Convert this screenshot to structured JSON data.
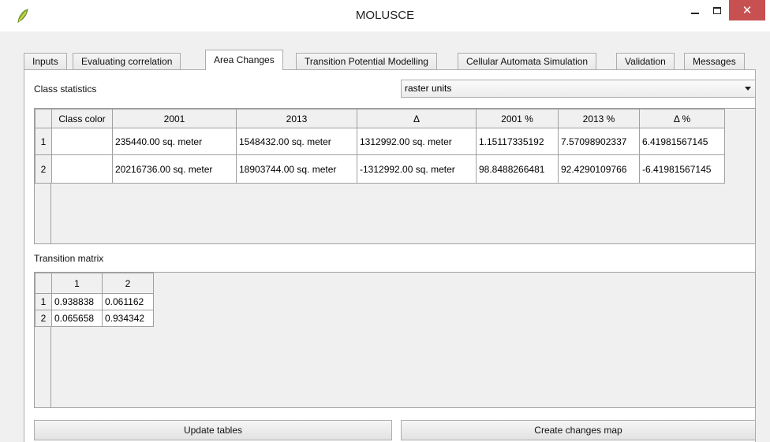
{
  "window": {
    "title": "MOLUSCE",
    "minimize_symbol": "–",
    "close_symbol": "✕",
    "app_icon": "qgis-leaf-icon"
  },
  "tabs": [
    {
      "label": "Inputs",
      "active": false
    },
    {
      "label": "Evaluating correlation",
      "active": false
    },
    {
      "label": "Area Changes",
      "active": true
    },
    {
      "label": "Transition Potential Modelling",
      "active": false
    },
    {
      "label": "Cellular Automata Simulation",
      "active": false
    },
    {
      "label": "Validation",
      "active": false
    },
    {
      "label": "Messages",
      "active": false
    }
  ],
  "class_statistics": {
    "label": "Class statistics",
    "units_selected": "raster units",
    "columns": [
      "Class color",
      "2001",
      "2013",
      "Δ",
      "2001 %",
      "2013 %",
      "Δ %"
    ],
    "rows": [
      {
        "header": "1",
        "cells": [
          "",
          "235440.00 sq. meter",
          "1548432.00 sq. meter",
          "1312992.00 sq. meter",
          "1.15117335192",
          "7.57098902337",
          "6.41981567145"
        ]
      },
      {
        "header": "2",
        "cells": [
          "",
          "20216736.00 sq. meter",
          "18903744.00 sq. meter",
          "-1312992.00 sq. meter",
          "98.8488266481",
          "92.4290109766",
          "-6.41981567145"
        ]
      }
    ]
  },
  "transition_matrix": {
    "label": "Transition matrix",
    "columns": [
      "1",
      "2"
    ],
    "rows": [
      {
        "header": "1",
        "cells": [
          "0.938838",
          "0.061162"
        ]
      },
      {
        "header": "2",
        "cells": [
          "0.065658",
          "0.934342"
        ]
      }
    ]
  },
  "buttons": {
    "update_tables": "Update tables",
    "create_changes_map": "Create changes map"
  }
}
